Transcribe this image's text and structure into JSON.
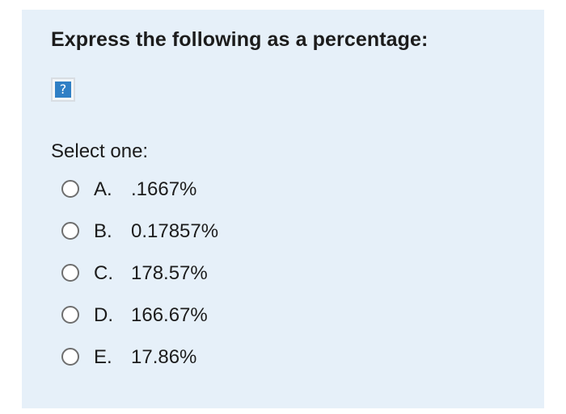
{
  "question": {
    "prompt": "Express the following as a percentage:",
    "image_placeholder_icon": "question-mark-icon",
    "image_placeholder_glyph": "?",
    "select_label": "Select one:",
    "options": [
      {
        "letter": "A.",
        "value": ".1667%",
        "selected": false
      },
      {
        "letter": "B.",
        "value": "0.17857%",
        "selected": false
      },
      {
        "letter": "C.",
        "value": "178.57%",
        "selected": false
      },
      {
        "letter": "D.",
        "value": "166.67%",
        "selected": false
      },
      {
        "letter": "E.",
        "value": "17.86%",
        "selected": false
      }
    ]
  },
  "colors": {
    "card_background": "#e6f0f9",
    "page_background": "#ffffff",
    "text": "#1c1c1c",
    "radio_border": "#6e6e6e",
    "placeholder_blue": "#2f7fc5"
  }
}
